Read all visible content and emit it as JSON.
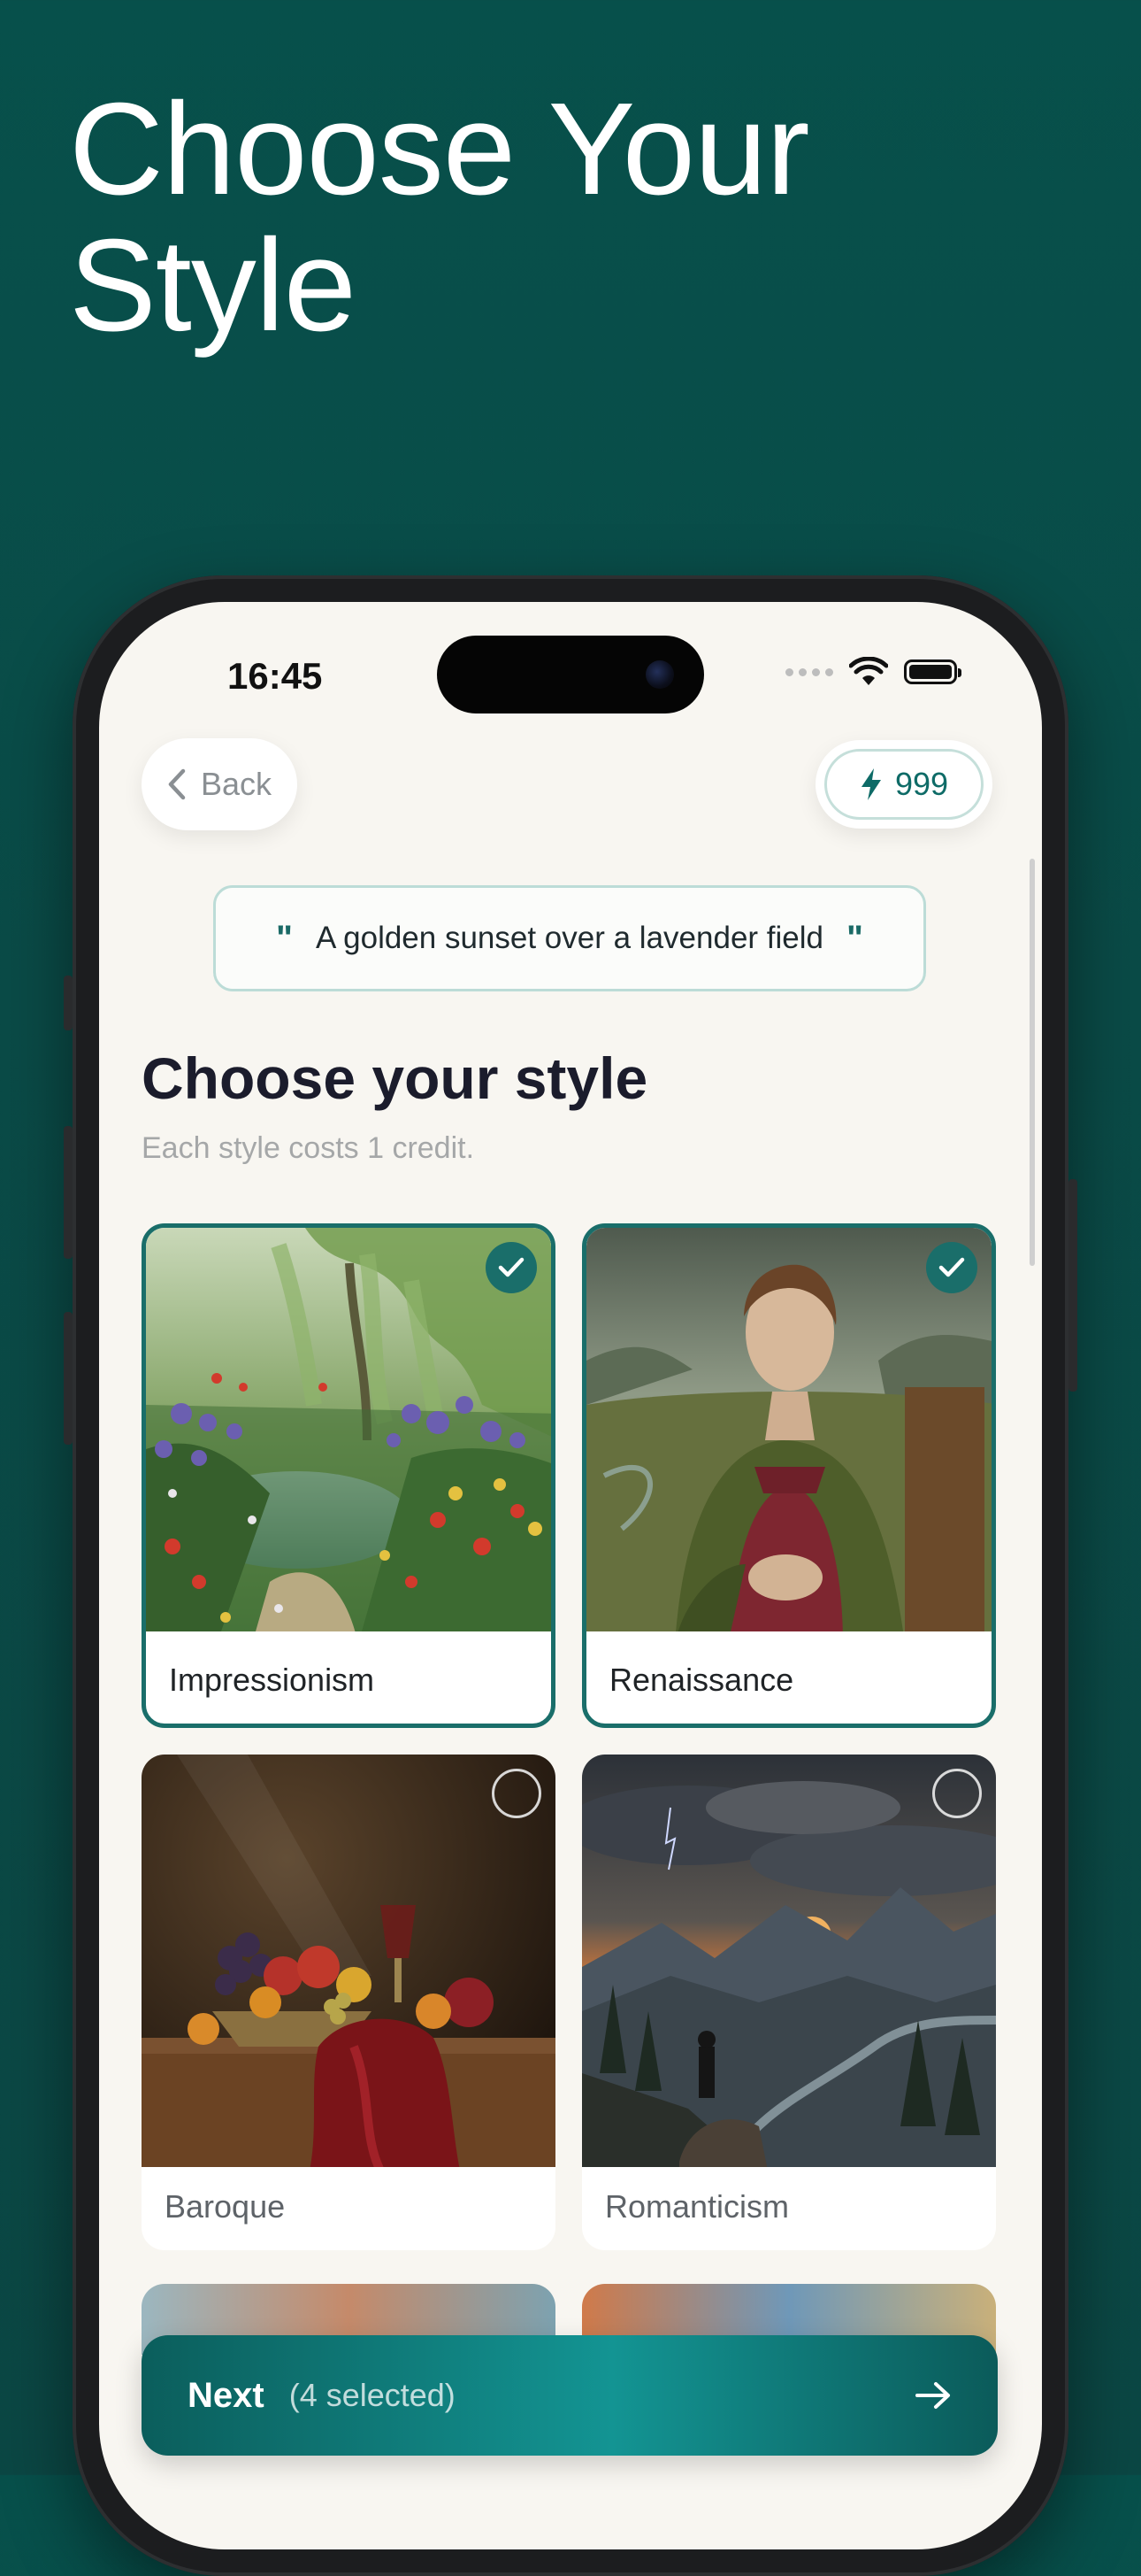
{
  "headline": {
    "line1": "Choose Your",
    "line2": "Style"
  },
  "status_bar": {
    "time": "16:45"
  },
  "nav": {
    "back_label": "Back",
    "credits": "999"
  },
  "prompt": {
    "open_quote": "\"",
    "text": "A golden sunset over a lavender field",
    "close_quote": "\""
  },
  "section": {
    "title": "Choose your style",
    "subtitle": "Each style costs 1 credit."
  },
  "styles": [
    {
      "label": "Impressionism",
      "selected": true
    },
    {
      "label": "Renaissance",
      "selected": true
    },
    {
      "label": "Baroque",
      "selected": false
    },
    {
      "label": "Romanticism",
      "selected": false
    }
  ],
  "next": {
    "label": "Next",
    "count": "(4 selected)"
  },
  "colors": {
    "accent": "#1a6e6a",
    "background": "#0a4b47",
    "screen": "#f8f6f1"
  },
  "icons": [
    "chevron-left-icon",
    "bolt-icon",
    "check-icon",
    "arrow-right-icon",
    "wifi-icon",
    "battery-icon"
  ]
}
